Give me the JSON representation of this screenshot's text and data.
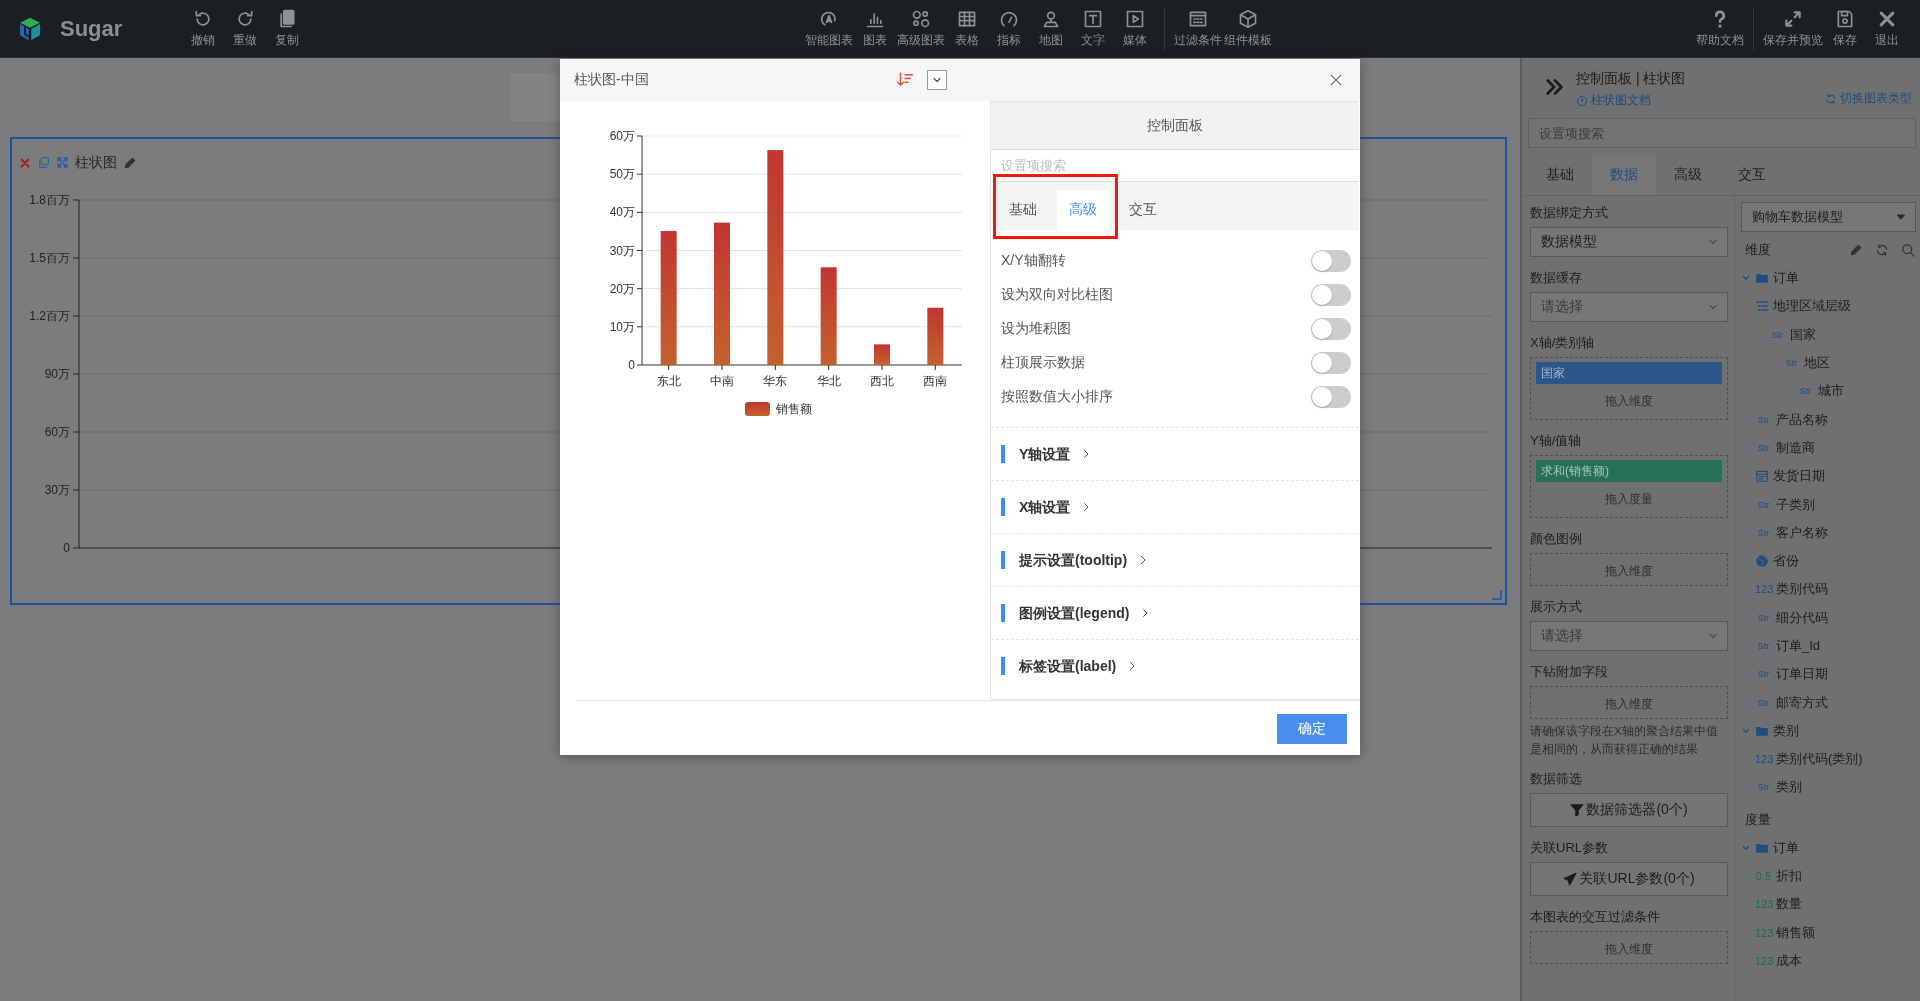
{
  "topbar": {
    "brand": "Sugar",
    "left_tools": [
      {
        "label": "撤销",
        "kind": "undo"
      },
      {
        "label": "重做",
        "kind": "redo"
      },
      {
        "label": "复制",
        "kind": "copy"
      }
    ],
    "center_tools": [
      [
        {
          "label": "智能图表",
          "kind": "smart"
        },
        {
          "label": "图表",
          "kind": "bar"
        },
        {
          "label": "高级图表",
          "kind": "circles"
        },
        {
          "label": "表格",
          "kind": "table"
        },
        {
          "label": "指标",
          "kind": "gauge"
        },
        {
          "label": "地图",
          "kind": "pin"
        },
        {
          "label": "文字",
          "kind": "text"
        },
        {
          "label": "媒体",
          "kind": "play"
        }
      ],
      [
        {
          "label": "过滤条件",
          "kind": "calendar"
        },
        {
          "label": "组件模板",
          "kind": "cube"
        }
      ]
    ],
    "right_tools": [
      [
        {
          "label": "帮助文档",
          "kind": "help"
        }
      ],
      [
        {
          "label": "保存并预览",
          "kind": "expand"
        },
        {
          "label": "保存",
          "kind": "save"
        },
        {
          "label": "退出",
          "kind": "close"
        }
      ]
    ]
  },
  "canvas": {
    "widget": {
      "title": "柱状图",
      "selected": true,
      "y_ticks": [
        "1.8百万",
        "1.5百万",
        "1.2百万",
        "90万",
        "60万",
        "30万",
        "0"
      ]
    }
  },
  "modal": {
    "title": "柱状图-中国",
    "chart_data": {
      "type": "bar",
      "categories": [
        "东北",
        "中南",
        "华东",
        "华北",
        "西北",
        "西南"
      ],
      "series": [
        {
          "name": "销售额",
          "color": "#c23531",
          "values": [
            35.1,
            37.3,
            56.3,
            25.6,
            5.4,
            15.0
          ]
        }
      ],
      "ylim": [
        0,
        60
      ],
      "grid": true,
      "yticks": [
        {
          "value": 0,
          "label": "0"
        },
        {
          "value": 10,
          "label": "10万"
        },
        {
          "value": 20,
          "label": "20万"
        },
        {
          "value": 30,
          "label": "30万"
        },
        {
          "value": 40,
          "label": "40万"
        },
        {
          "value": 50,
          "label": "50万"
        },
        {
          "value": 60,
          "label": "60万"
        }
      ]
    },
    "control_panel": {
      "title": "控制面板",
      "search": {
        "placeholder": "设置项搜索"
      },
      "tabs_highlighted": true,
      "tabs": [
        {
          "label": "基础",
          "selected": false
        },
        {
          "label": "高级",
          "selected": true
        },
        {
          "label": "交互",
          "selected": false
        }
      ],
      "toggles": [
        {
          "label": "X/Y轴翻转",
          "on": false
        },
        {
          "label": "设为双向对比柱图",
          "on": false
        },
        {
          "label": "设为堆积图",
          "on": false
        },
        {
          "label": "柱顶展示数据",
          "on": false
        },
        {
          "label": "按照数值大小排序",
          "on": false
        }
      ],
      "sections": [
        {
          "label": "Y轴设置"
        },
        {
          "label": "X轴设置"
        },
        {
          "label": "提示设置(tooltip)"
        },
        {
          "label": "图例设置(legend)"
        },
        {
          "label": "标签设置(label)"
        }
      ]
    },
    "confirm_button": "确定"
  },
  "sidebar": {
    "title": "控制面板 | 柱状图",
    "doc_link": "柱状图文档",
    "switch_link": "切换图表类型",
    "search": {
      "placeholder": "设置项搜索"
    },
    "tabs": [
      {
        "label": "基础",
        "selected": false
      },
      {
        "label": "数据",
        "selected": true
      },
      {
        "label": "高级",
        "selected": false
      },
      {
        "label": "交互",
        "selected": false
      }
    ],
    "settings": [
      {
        "kind": "select",
        "label": "数据绑定方式",
        "value": "数据模型"
      },
      {
        "kind": "select",
        "label": "数据缓存",
        "placeholder": "请选择"
      },
      {
        "kind": "dropzone",
        "label": "X轴/类别轴",
        "chips": [
          {
            "label": "国家",
            "kind": "dimension"
          }
        ],
        "hint": "拖入维度"
      },
      {
        "kind": "dropzone",
        "label": "Y轴/值轴",
        "chips": [
          {
            "label": "求和(销售额)",
            "kind": "measure"
          }
        ],
        "hint": "拖入度量"
      },
      {
        "kind": "dropzone",
        "label": "颜色图例",
        "hint": "拖入维度"
      },
      {
        "kind": "select",
        "label": "展示方式",
        "placeholder": "请选择"
      },
      {
        "kind": "dropzone",
        "label": "下钻附加字段",
        "hint": "拖入维度",
        "note": "请确保该字段在X轴的聚合结果中值是相同的，从而获得正确的结果"
      },
      {
        "kind": "filter",
        "label": "数据筛选",
        "button": "数据筛选器(0个)"
      },
      {
        "kind": "link",
        "label": "关联URL参数",
        "button": "关联URL参数(0个)"
      },
      {
        "kind": "dropzone",
        "label": "本图表的交互过滤条件",
        "hint": "拖入维度"
      }
    ],
    "model_select": {
      "value": "购物车数据模型"
    },
    "field_groups": [
      {
        "heading": "维度",
        "kind": "dimension",
        "tree": [
          {
            "label": "订单",
            "kind": "folder",
            "expanded": true,
            "children": [
              {
                "label": "地理区域层级",
                "kind": "hierarchy",
                "children": [
                  {
                    "label": "国家",
                    "kind": "field",
                    "badge": "Str",
                    "children": [
                      {
                        "label": "地区",
                        "kind": "field",
                        "badge": "Str",
                        "children": [
                          {
                            "label": "城市",
                            "kind": "field",
                            "badge": "Str"
                          }
                        ]
                      }
                    ]
                  }
                ]
              },
              {
                "label": "产品名称",
                "kind": "field",
                "badge": "Str"
              },
              {
                "label": "制造商",
                "kind": "field",
                "badge": "Str"
              },
              {
                "label": "发货日期",
                "kind": "date"
              },
              {
                "label": "子类别",
                "kind": "field",
                "badge": "Str"
              },
              {
                "label": "客户名称",
                "kind": "field",
                "badge": "Str"
              },
              {
                "label": "省份",
                "kind": "geo"
              },
              {
                "label": "类别代码",
                "kind": "field",
                "badge": "123"
              },
              {
                "label": "细分代码",
                "kind": "field",
                "badge": "Str"
              },
              {
                "label": "订单_Id",
                "kind": "field",
                "badge": "Str"
              },
              {
                "label": "订单日期",
                "kind": "field",
                "badge": "Str"
              },
              {
                "label": "邮寄方式",
                "kind": "field",
                "badge": "Str"
              }
            ]
          },
          {
            "label": "类别",
            "kind": "folder",
            "expanded": true,
            "children": [
              {
                "label": "类别代码(类别)",
                "kind": "field",
                "badge": "123"
              },
              {
                "label": "类别",
                "kind": "field",
                "badge": "Str"
              }
            ]
          }
        ]
      },
      {
        "heading": "度量",
        "kind": "measure",
        "tree": [
          {
            "label": "订单",
            "kind": "folder",
            "expanded": true,
            "children": [
              {
                "label": "折扣",
                "kind": "field",
                "badge": "0.5"
              },
              {
                "label": "数量",
                "kind": "field",
                "badge": "123"
              },
              {
                "label": "销售额",
                "kind": "field",
                "badge": "123"
              },
              {
                "label": "成本",
                "kind": "field",
                "badge": "123"
              }
            ]
          }
        ]
      }
    ]
  }
}
